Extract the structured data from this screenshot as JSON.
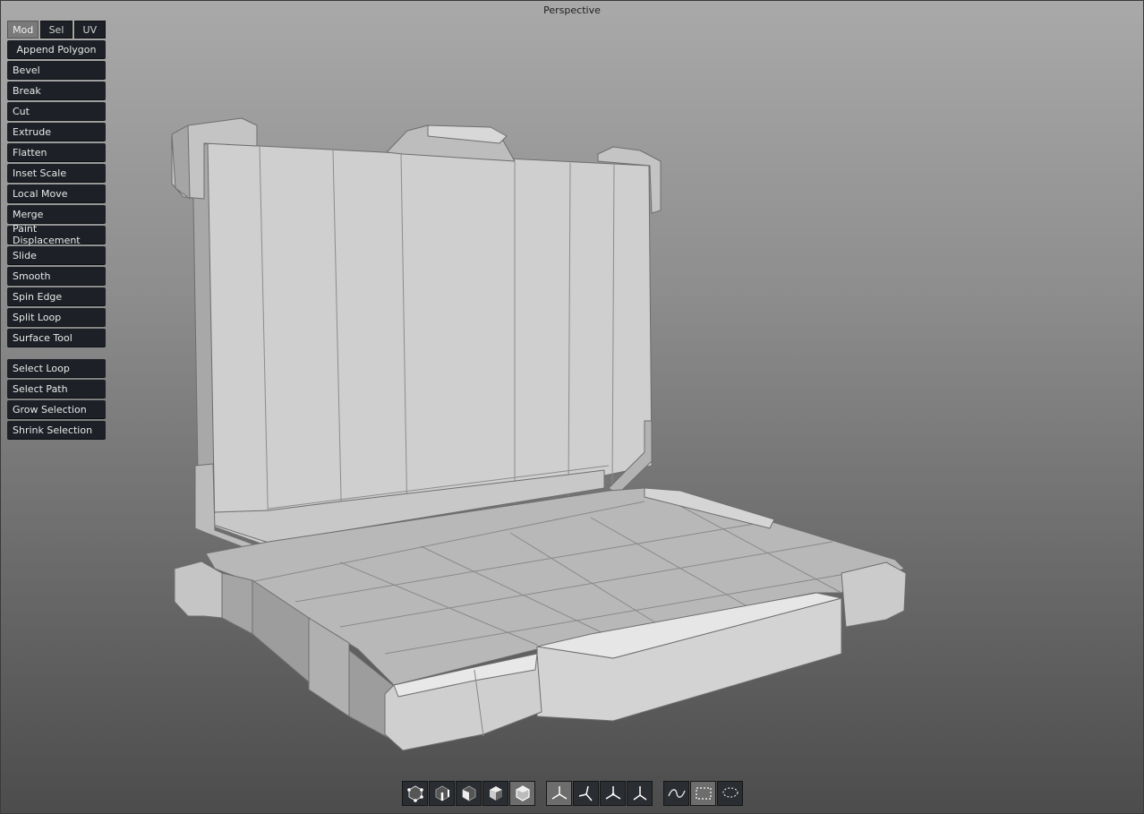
{
  "viewport": {
    "title": "Perspective"
  },
  "mode_tabs": [
    {
      "label": "Mod",
      "active": true
    },
    {
      "label": "Sel",
      "active": false
    },
    {
      "label": "UV",
      "active": false
    }
  ],
  "tools": [
    "Append Polygon",
    "Bevel",
    "Break",
    "Cut",
    "Extrude",
    "Flatten",
    "Inset Scale",
    "Local Move",
    "Merge",
    "Paint Displacement",
    "Slide",
    "Smooth",
    "Spin Edge",
    "Split Loop",
    "Surface Tool"
  ],
  "selection_tools": [
    "Select Loop",
    "Select Path",
    "Grow Selection",
    "Shrink Selection"
  ],
  "component_modes": [
    {
      "icon": "vertex-mode-icon",
      "active": false
    },
    {
      "icon": "edge-mode-icon",
      "active": false
    },
    {
      "icon": "face-mode-icon",
      "active": false
    },
    {
      "icon": "element-mode-icon",
      "active": false
    },
    {
      "icon": "object-mode-icon",
      "active": true
    }
  ],
  "transform_spaces": [
    {
      "icon": "world-axis-icon",
      "active": true
    },
    {
      "icon": "local-axis-icon",
      "active": false
    },
    {
      "icon": "screen-axis-icon",
      "active": false
    },
    {
      "icon": "normal-axis-icon",
      "active": false
    }
  ],
  "selection_shapes": [
    {
      "icon": "freehand-select-icon",
      "active": false
    },
    {
      "icon": "rectangle-select-icon",
      "active": true
    },
    {
      "icon": "lasso-select-icon",
      "active": false
    }
  ],
  "colors": {
    "button_bg": "#1d2127",
    "active_tab": "#7a7a7a",
    "mesh_light": "#d6d6d6",
    "mesh_mid": "#bdbdbd",
    "mesh_dark": "#9a9a9a"
  }
}
